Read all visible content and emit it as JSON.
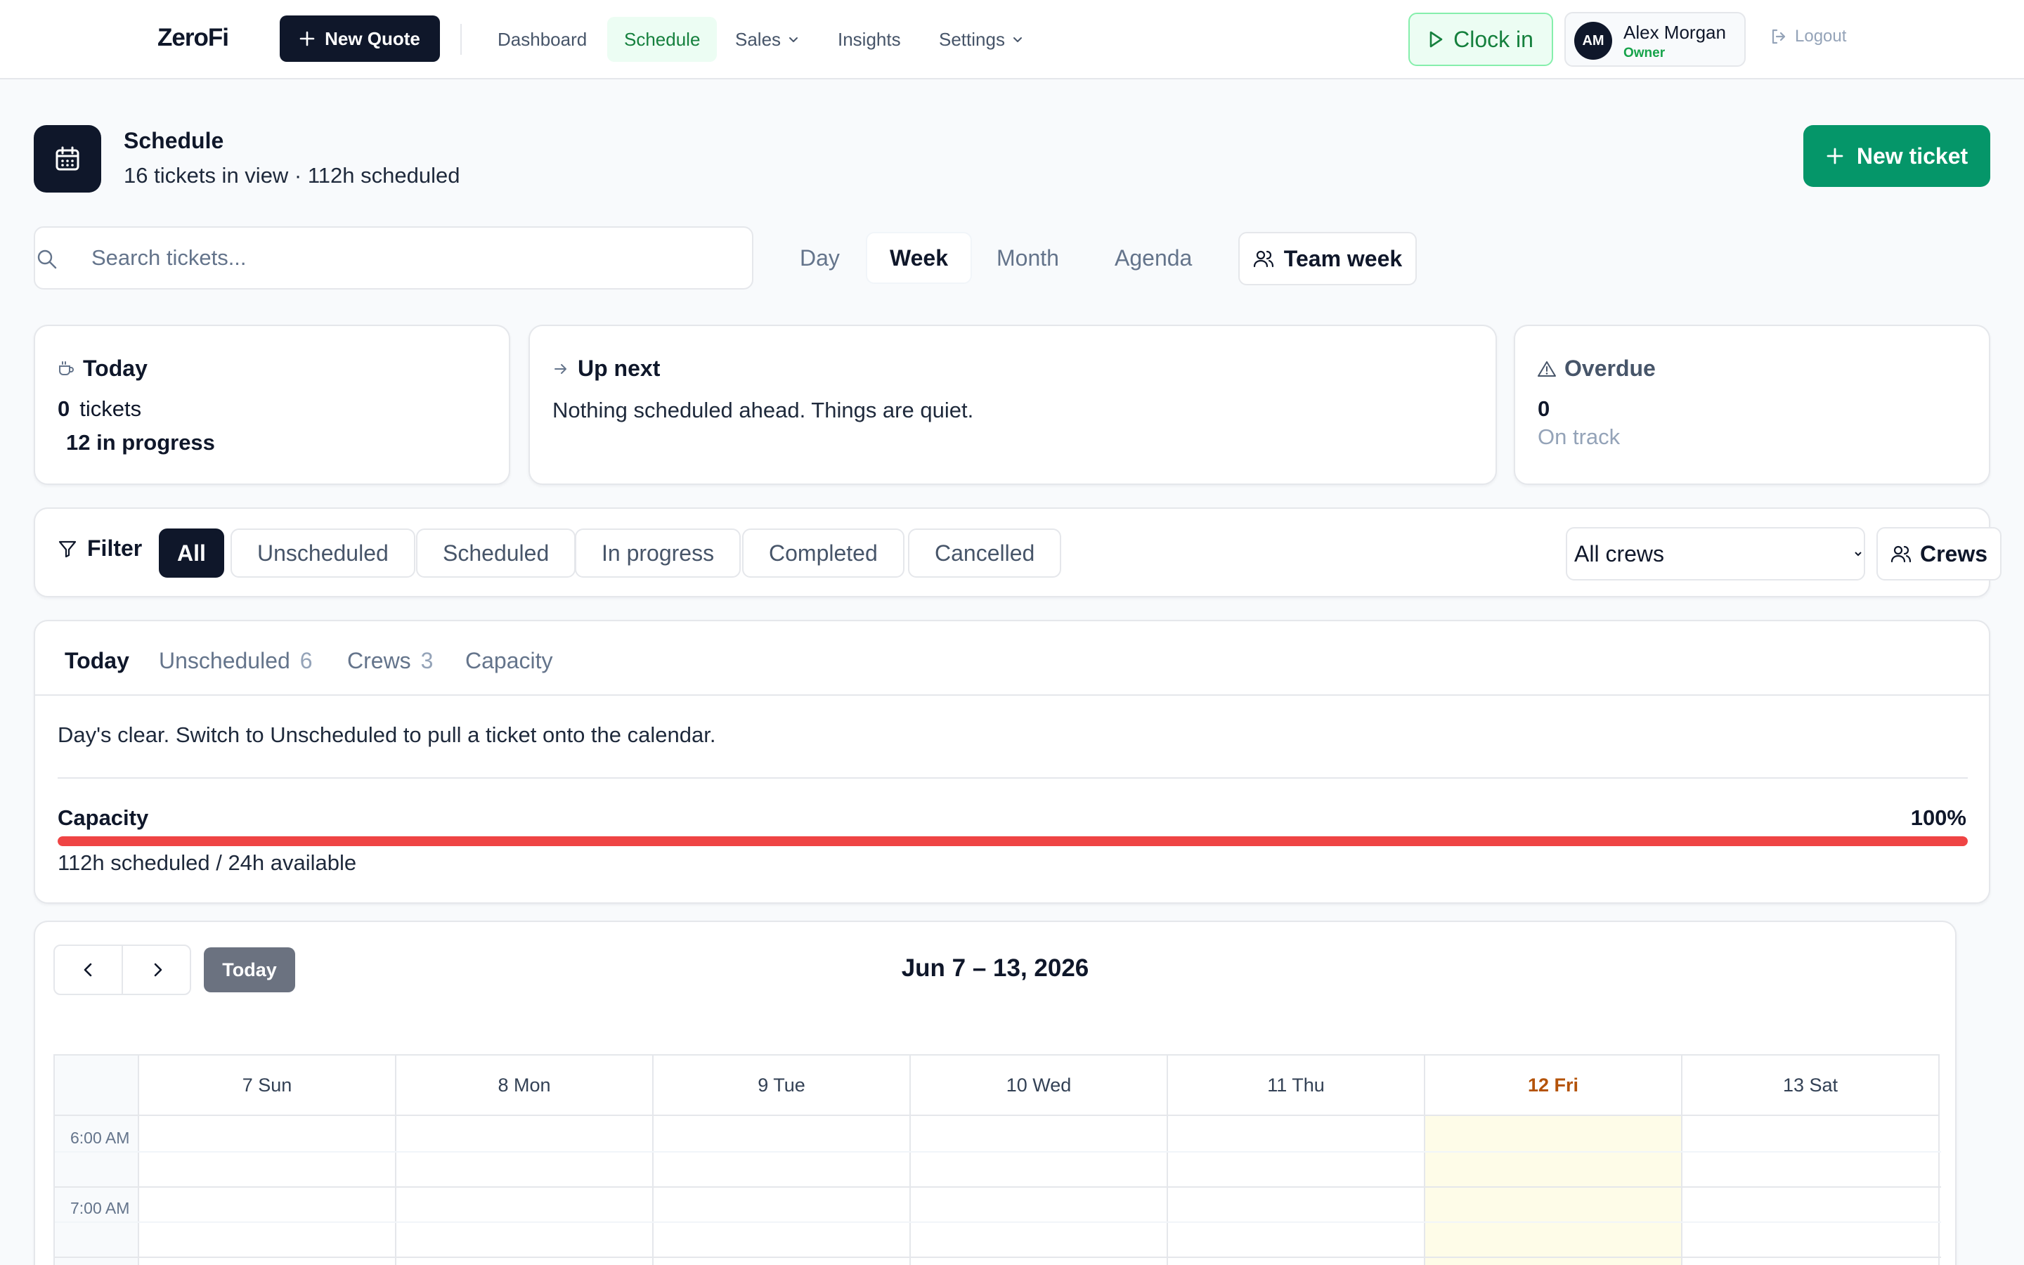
{
  "app": {
    "name": "ZeroFi"
  },
  "nav": {
    "new_quote": "New Quote",
    "links": [
      "Dashboard",
      "Schedule",
      "Sales",
      "Insights",
      "Settings"
    ],
    "active": "Schedule",
    "clock_in": "Clock in",
    "user": {
      "initials": "AM",
      "name": "Alex Morgan",
      "role": "Owner"
    },
    "logout": "Logout"
  },
  "header": {
    "title": "Schedule",
    "subtitle": "16 tickets in view · 112h scheduled",
    "new_ticket": "New ticket"
  },
  "search": {
    "placeholder": "Search tickets..."
  },
  "views": {
    "tabs": [
      "Day",
      "Week",
      "Month",
      "Agenda"
    ],
    "active": "Week",
    "team_week": "Team week"
  },
  "cards": {
    "today": {
      "title": "Today",
      "count": "0",
      "count_label": "tickets",
      "in_progress": "12 in progress"
    },
    "up_next": {
      "title": "Up next",
      "text": "Nothing scheduled ahead. Things are quiet."
    },
    "overdue": {
      "title": "Overdue",
      "count": "0",
      "status": "On track"
    }
  },
  "filter": {
    "label": "Filter",
    "chips": [
      "All",
      "Unscheduled",
      "Scheduled",
      "In progress",
      "Completed",
      "Cancelled"
    ],
    "active": "All",
    "crew_select": "All crews",
    "crews_button": "Crews"
  },
  "panel": {
    "tabs": [
      {
        "label": "Today",
        "count": ""
      },
      {
        "label": "Unscheduled",
        "count": "6"
      },
      {
        "label": "Crews",
        "count": "3"
      },
      {
        "label": "Capacity",
        "count": ""
      }
    ],
    "active": "Today",
    "message": "Day's clear. Switch to Unscheduled to pull a ticket onto the calendar.",
    "capacity": {
      "label": "Capacity",
      "percent_label": "100%",
      "fill_fraction": 1.0,
      "detail": "112h scheduled / 24h available"
    }
  },
  "calendar": {
    "today_button": "Today",
    "range": "Jun 7 – 13, 2026",
    "days": [
      "7 Sun",
      "8 Mon",
      "9 Tue",
      "10 Wed",
      "11 Thu",
      "12 Fri",
      "13 Sat"
    ],
    "today_index": 5,
    "times": [
      "6:00 AM",
      "7:00 AM"
    ]
  },
  "colors": {
    "brand_dark": "#0f172a",
    "accent_green": "#059669",
    "capacity_red": "#ef4444",
    "today_highlight": "#fefce8"
  }
}
